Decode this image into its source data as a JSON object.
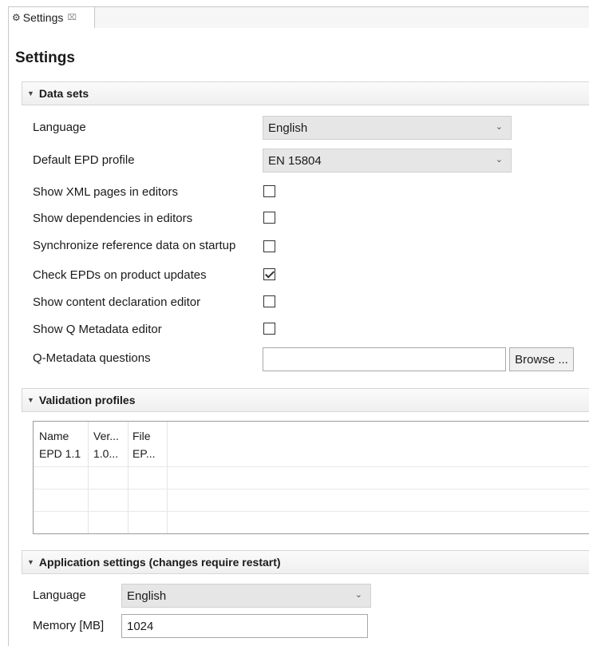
{
  "tab": {
    "icon": "gear-icon",
    "label": "Settings",
    "close_icon": "close-icon",
    "close_glyph": "⌧"
  },
  "page_title": "Settings",
  "data_sets": {
    "header": "Data sets",
    "language_label": "Language",
    "language_value": "English",
    "epd_profile_label": "Default EPD profile",
    "epd_profile_value": "EN 15804",
    "show_xml_label": "Show XML pages in editors",
    "show_xml_checked": false,
    "show_deps_label": "Show dependencies in editors",
    "show_deps_checked": false,
    "sync_ref_label": "Synchronize reference data on startup",
    "sync_ref_checked": false,
    "check_epds_label": "Check EPDs on product updates",
    "check_epds_checked": true,
    "show_content_decl_label": "Show content declaration editor",
    "show_content_decl_checked": false,
    "show_q_meta_label": "Show Q Metadata editor",
    "show_q_meta_checked": false,
    "q_questions_label": "Q-Metadata questions",
    "q_questions_value": "",
    "browse_label": "Browse ..."
  },
  "validation_profiles": {
    "header": "Validation profiles",
    "columns": [
      "Name",
      "Ver...",
      "File"
    ],
    "rows": [
      [
        "EPD 1.1",
        "1.0...",
        "EP..."
      ]
    ]
  },
  "application_settings": {
    "header": "Application settings (changes require restart)",
    "language_label": "Language",
    "language_value": "English",
    "memory_label": "Memory [MB]",
    "memory_value": "1024"
  }
}
